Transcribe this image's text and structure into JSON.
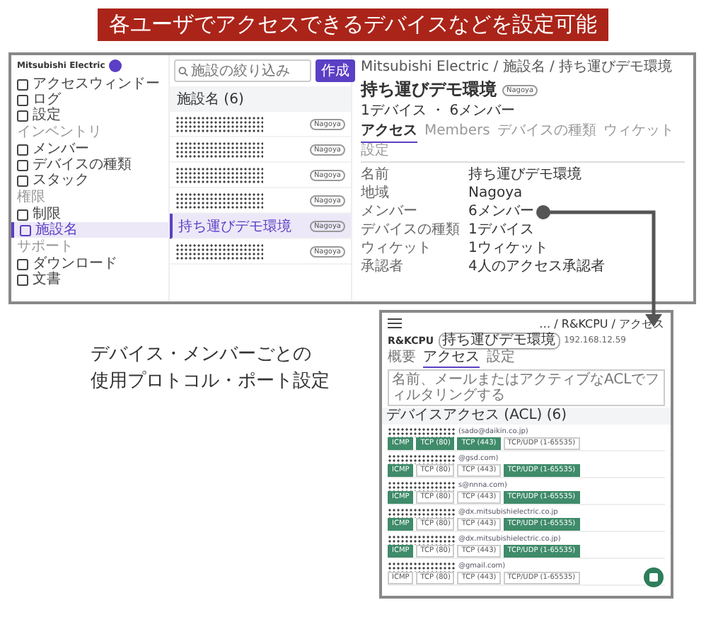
{
  "banner": "各ユーザでアクセスできるデバイスなどを設定可能",
  "main": {
    "org": "Mitsubishi Electric",
    "sidebar": [
      {
        "kind": "item",
        "label": "アクセスウィンドー",
        "selected": false
      },
      {
        "kind": "item",
        "label": "ログ",
        "selected": false
      },
      {
        "kind": "item",
        "label": "設定",
        "selected": false
      },
      {
        "kind": "heading",
        "label": "インベントリ"
      },
      {
        "kind": "item",
        "label": "メンバー",
        "selected": false
      },
      {
        "kind": "item",
        "label": "デバイスの種類",
        "selected": false
      },
      {
        "kind": "item",
        "label": "スタック",
        "selected": false
      },
      {
        "kind": "heading",
        "label": "権限"
      },
      {
        "kind": "item",
        "label": "制限",
        "selected": false
      },
      {
        "kind": "item",
        "label": "施設名",
        "selected": true
      },
      {
        "kind": "heading",
        "label": "サポート"
      },
      {
        "kind": "item",
        "label": "ダウンロード",
        "selected": false
      },
      {
        "kind": "item",
        "label": "文書",
        "selected": false
      }
    ],
    "search": {
      "placeholder": "施設の絞り込み"
    },
    "create_button": "作成",
    "list_header": "施設名 (6)",
    "rows": [
      {
        "kind": "masked",
        "tag": "Nagoya",
        "selected": false
      },
      {
        "kind": "masked",
        "tag": "Nagoya",
        "selected": false
      },
      {
        "kind": "masked",
        "tag": "Nagoya",
        "selected": false
      },
      {
        "kind": "masked",
        "tag": "Nagoya",
        "selected": false
      },
      {
        "kind": "named",
        "name": "持ち運びデモ環境",
        "tag": "Nagoya",
        "selected": true
      },
      {
        "kind": "masked",
        "tag": "Nagoya",
        "selected": false
      }
    ],
    "breadcrumb": "Mitsubishi Electric / 施設名 / 持ち運びデモ環境",
    "title": "持ち運びデモ環境",
    "title_tag": "Nagoya",
    "subtitle": "1デバイス ・ 6メンバー",
    "tabs": [
      {
        "label": "アクセス",
        "selected": true
      },
      {
        "label": "Members",
        "selected": false
      },
      {
        "label": "デバイスの種類",
        "selected": false
      },
      {
        "label": "ウィケット",
        "selected": false
      },
      {
        "label": "設定",
        "selected": false
      }
    ],
    "fields": [
      {
        "label": "名前",
        "value": "持ち運びデモ環境"
      },
      {
        "label": "地域",
        "value": "Nagoya"
      },
      {
        "label": "メンバー",
        "value": "6メンバー"
      },
      {
        "label": "デバイスの種類",
        "value": "1デバイス"
      },
      {
        "label": "ウィケット",
        "value": "1ウィケット"
      },
      {
        "label": "承認者",
        "value": "4人のアクセス承認者"
      }
    ]
  },
  "caption": [
    "デバイス・メンバーごとの",
    "使用プロトコル・ポート設定"
  ],
  "phone": {
    "breadcrumb": "… / R&KCPU / アクセス",
    "title": "R&KCPU",
    "tag": "持ち運びデモ環境",
    "ip": "192.168.12.59",
    "tabs": [
      {
        "label": "概要",
        "selected": false
      },
      {
        "label": "アクセス",
        "selected": true
      },
      {
        "label": "設定",
        "selected": false
      }
    ],
    "search": {
      "placeholder": "名前、メールまたはアクティブなACLでフィルタリングする"
    },
    "section": "デバイスアクセス (ACL) (6)",
    "entries": [
      {
        "email": "(sado@daikin.co.jp)",
        "protocols": [
          {
            "label": "ICMP",
            "on": true
          },
          {
            "label": "TCP (80)",
            "on": true
          },
          {
            "label": "TCP (443)",
            "on": true
          },
          {
            "label": "TCP/UDP (1-65535)",
            "on": false
          }
        ]
      },
      {
        "email": "@gsd.com)",
        "protocols": [
          {
            "label": "ICMP",
            "on": true
          },
          {
            "label": "TCP (80)",
            "on": false
          },
          {
            "label": "TCP (443)",
            "on": false
          },
          {
            "label": "TCP/UDP (1-65535)",
            "on": true
          }
        ]
      },
      {
        "email": "s@nnna.com)",
        "protocols": [
          {
            "label": "ICMP",
            "on": true
          },
          {
            "label": "TCP (80)",
            "on": false
          },
          {
            "label": "TCP (443)",
            "on": false
          },
          {
            "label": "TCP/UDP (1-65535)",
            "on": true
          }
        ]
      },
      {
        "email": "@dx.mitsubishielectric.co.jp",
        "protocols": [
          {
            "label": "ICMP",
            "on": true
          },
          {
            "label": "TCP (80)",
            "on": false
          },
          {
            "label": "TCP (443)",
            "on": false
          },
          {
            "label": "TCP/UDP (1-65535)",
            "on": true
          }
        ]
      },
      {
        "email": "@dx.mitsubishielectric.co.jp)",
        "protocols": [
          {
            "label": "ICMP",
            "on": true
          },
          {
            "label": "TCP (80)",
            "on": false
          },
          {
            "label": "TCP (443)",
            "on": false
          },
          {
            "label": "TCP/UDP (1-65535)",
            "on": true
          }
        ]
      },
      {
        "email": "@gmail.com)",
        "protocols": [
          {
            "label": "ICMP",
            "on": false
          },
          {
            "label": "TCP (80)",
            "on": false
          },
          {
            "label": "TCP (443)",
            "on": false
          },
          {
            "label": "TCP/UDP (1-65535)",
            "on": false
          }
        ]
      }
    ]
  }
}
